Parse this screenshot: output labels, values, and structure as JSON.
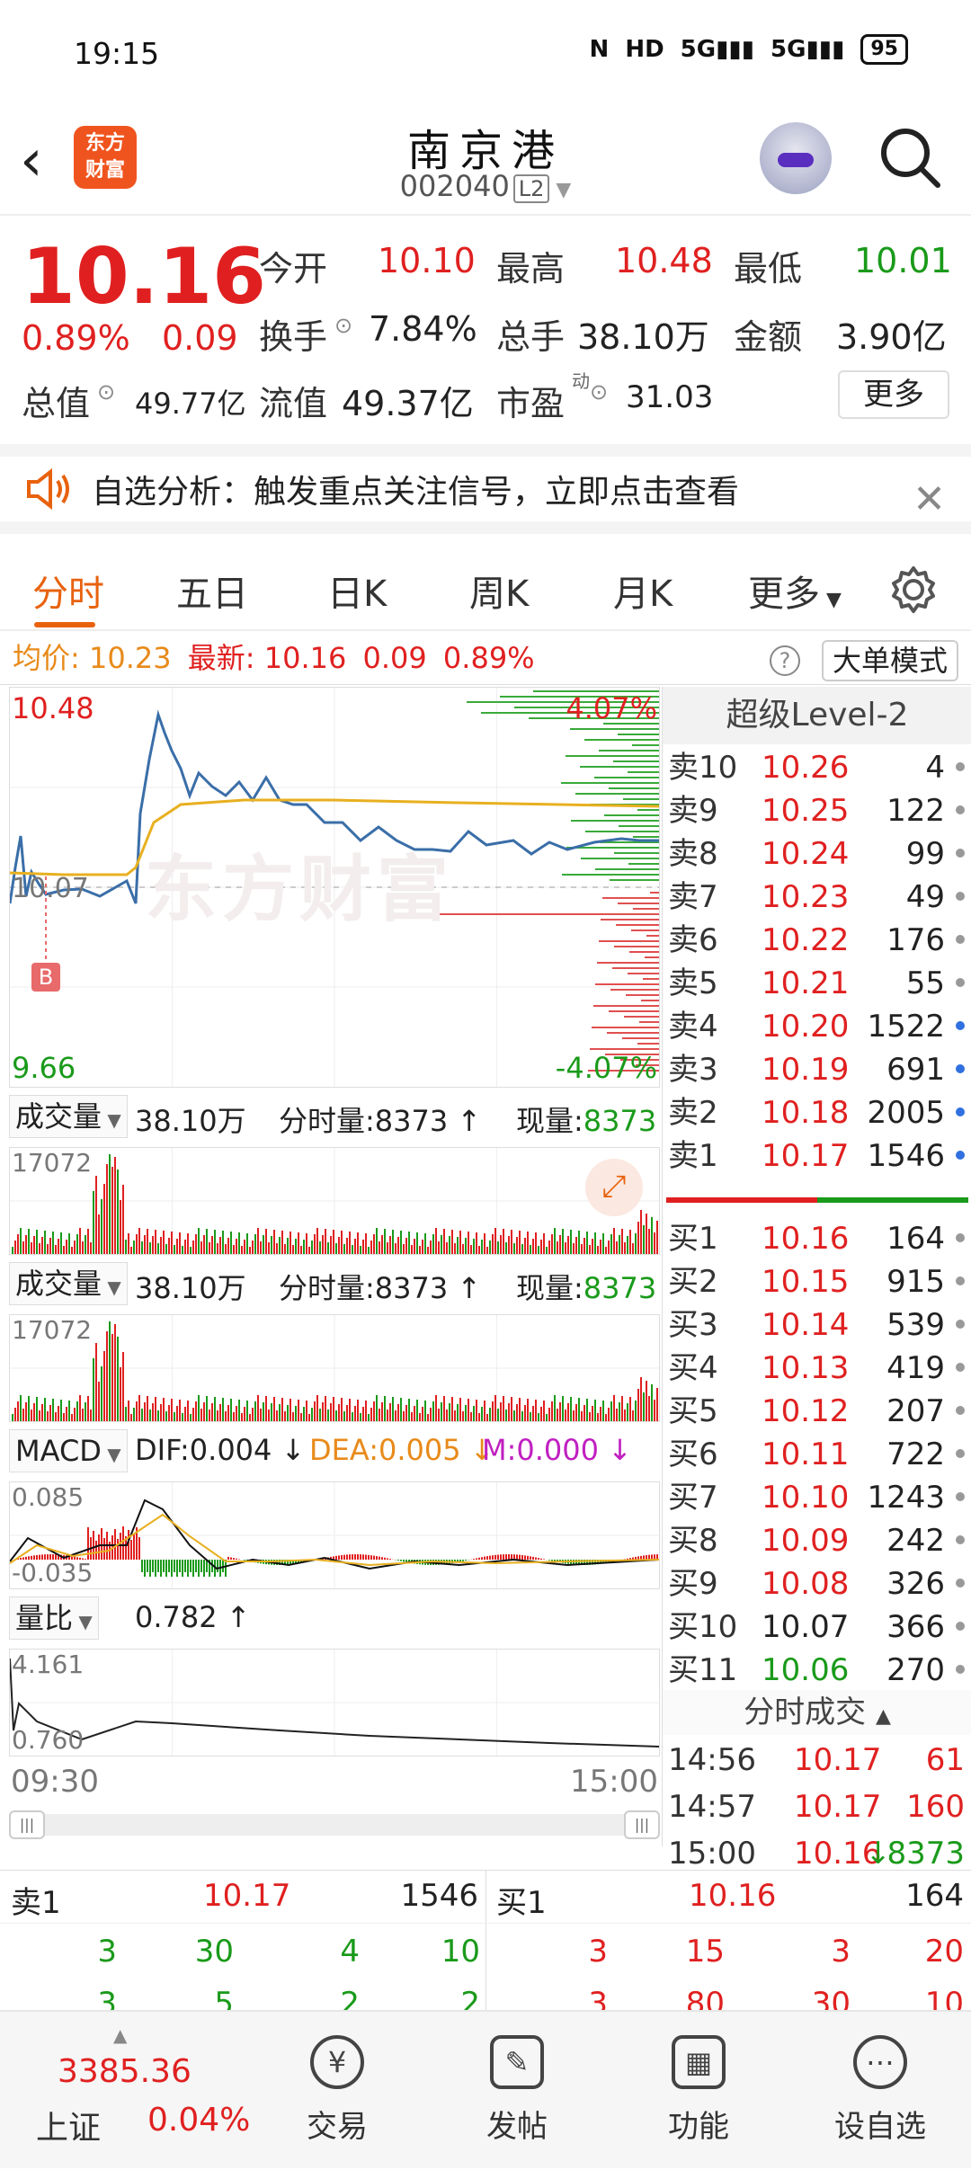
{
  "status_bar": {
    "time": "19:15",
    "battery": "95",
    "network": "5G"
  },
  "header": {
    "logo_text": "东方财富",
    "title": "南京港",
    "code": "002040",
    "level_badge": "L2"
  },
  "quote": {
    "price": "10.16",
    "change_pct": "0.89%",
    "change": "0.09",
    "open_label": "今开",
    "open": "10.10",
    "high_label": "最高",
    "high": "10.48",
    "low_label": "最低",
    "low": "10.01",
    "turnover_label": "换手",
    "turnover": "7.84%",
    "volume_label": "总手",
    "volume": "38.10万",
    "amount_label": "金额",
    "amount": "3.90亿",
    "mktcap_label": "总值",
    "mktcap": "49.77亿",
    "float_label": "流值",
    "float_cap": "49.37亿",
    "pe_label": "市盈",
    "pe_sup": "动",
    "pe": "31.03",
    "more_label": "更多"
  },
  "notice": {
    "text": "自选分析：触发重点关注信号，立即点击查看"
  },
  "tabs": [
    "分时",
    "五日",
    "日K",
    "周K",
    "月K",
    "更多"
  ],
  "avg_line": {
    "avg_label": "均价:",
    "avg": "10.23",
    "last_label": "最新:",
    "last": "10.16",
    "chg": "0.09",
    "pct": "0.89%",
    "bigmode": "大单模式"
  },
  "intraday": {
    "top_price": "10.48",
    "top_pct": "4.07%",
    "bottom_price": "9.66",
    "bottom_pct": "-4.07%",
    "mid_price": "10.07",
    "marker": "B",
    "watermark": "东方财富"
  },
  "vol_panel": {
    "name": "成交量",
    "total": "38.10万",
    "fenshi": "分时量:8373",
    "now_label": "现量:",
    "now": "8373",
    "max": "17072"
  },
  "macd_panel": {
    "name": "MACD",
    "dif": "DIF:0.004",
    "dea": "DEA:0.005",
    "m": "M:0.000",
    "top": "0.085",
    "bottom": "-0.035"
  },
  "lb_panel": {
    "name": "量比",
    "value": "0.782",
    "top": "4.161",
    "bottom": "0.760"
  },
  "time_axis": {
    "start": "09:30",
    "end": "15:00"
  },
  "orderbook": {
    "title": "超级Level-2",
    "asks": [
      {
        "label": "卖10",
        "price": "10.26",
        "vol": "4"
      },
      {
        "label": "卖9",
        "price": "10.25",
        "vol": "122"
      },
      {
        "label": "卖8",
        "price": "10.24",
        "vol": "99"
      },
      {
        "label": "卖7",
        "price": "10.23",
        "vol": "49"
      },
      {
        "label": "卖6",
        "price": "10.22",
        "vol": "176"
      },
      {
        "label": "卖5",
        "price": "10.21",
        "vol": "55"
      },
      {
        "label": "卖4",
        "price": "10.20",
        "vol": "1522"
      },
      {
        "label": "卖3",
        "price": "10.19",
        "vol": "691"
      },
      {
        "label": "卖2",
        "price": "10.18",
        "vol": "2005"
      },
      {
        "label": "卖1",
        "price": "10.17",
        "vol": "1546"
      }
    ],
    "bids": [
      {
        "label": "买1",
        "price": "10.16",
        "vol": "164"
      },
      {
        "label": "买2",
        "price": "10.15",
        "vol": "915"
      },
      {
        "label": "买3",
        "price": "10.14",
        "vol": "539"
      },
      {
        "label": "买4",
        "price": "10.13",
        "vol": "419"
      },
      {
        "label": "买5",
        "price": "10.12",
        "vol": "207"
      },
      {
        "label": "买6",
        "price": "10.11",
        "vol": "722"
      },
      {
        "label": "买7",
        "price": "10.10",
        "vol": "1243"
      },
      {
        "label": "买8",
        "price": "10.09",
        "vol": "242"
      },
      {
        "label": "买9",
        "price": "10.08",
        "vol": "326"
      },
      {
        "label": "买10",
        "price": "10.07",
        "vol": "366"
      },
      {
        "label": "买11",
        "price": "10.06",
        "vol": "270"
      }
    ],
    "trades_title": "分时成交",
    "trades": [
      {
        "time": "14:56",
        "price": "10.17",
        "vol": "61"
      },
      {
        "time": "14:57",
        "price": "10.17",
        "vol": "160"
      },
      {
        "time": "15:00",
        "price": "10.16",
        "vol": "8373"
      }
    ]
  },
  "bottom_orderbook": {
    "sell_label": "卖1",
    "sell_price": "10.17",
    "sell_vol": "1546",
    "buy_label": "买1",
    "buy_price": "10.16",
    "buy_vol": "164",
    "sell_row1": [
      "3",
      "30",
      "4",
      "10"
    ],
    "sell_row2": [
      "3",
      "5",
      "2",
      "2"
    ],
    "buy_row1": [
      "3",
      "15",
      "3",
      "20"
    ],
    "buy_row2": [
      "3",
      "80",
      "30",
      "10"
    ]
  },
  "bottom_nav": {
    "index_value": "3385.36",
    "index_name": "上证",
    "index_pct": "0.04%",
    "items": [
      "交易",
      "发帖",
      "功能",
      "设自选"
    ]
  }
}
